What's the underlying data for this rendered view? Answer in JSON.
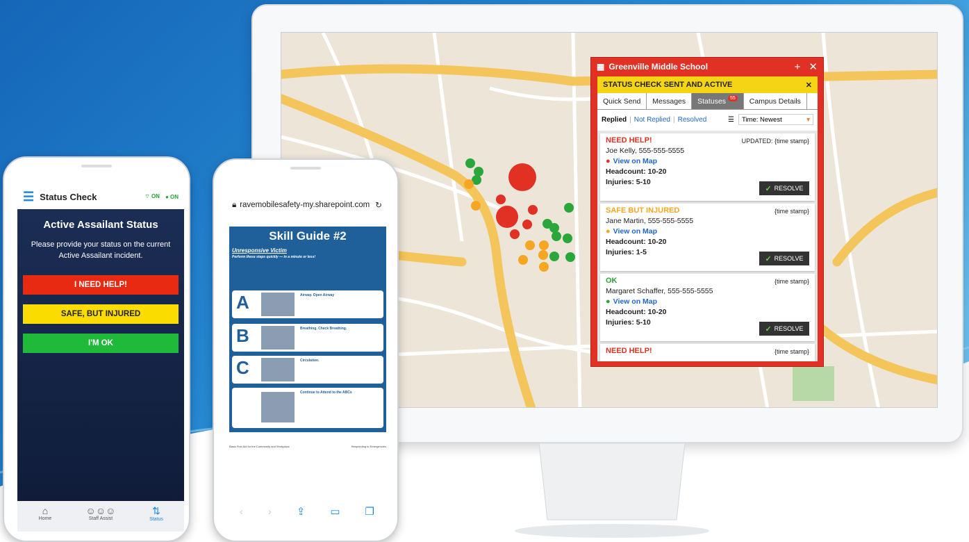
{
  "colors": {
    "accent": "#e03124",
    "banner": "#f5d416",
    "help": "#e82a12",
    "injured": "#fbdc00",
    "ok": "#1fba3a",
    "link": "#2266cc"
  },
  "panel": {
    "school": "Greenville Middle School",
    "banner": "STATUS CHECK SENT AND ACTIVE",
    "tabs": [
      {
        "label": "Quick Send"
      },
      {
        "label": "Messages"
      },
      {
        "label": "Statuses",
        "badge": "55"
      },
      {
        "label": "Campus Details"
      }
    ],
    "filters": {
      "replied": "Replied",
      "not_replied": "Not Replied",
      "resolved": "Resolved",
      "sort": "Time: Newest"
    },
    "cards": [
      {
        "status": "NEED HELP!",
        "color": "#e03124",
        "time": "UPDATED: {time stamp}",
        "name": "Joe Kelly, 555-555-5555",
        "view": "View on Map",
        "headcount": "Headcount: 10-20",
        "injuries": "Injuries: 5-10",
        "resolve": "RESOLVE"
      },
      {
        "status": "SAFE BUT INJURED",
        "color": "#f5a623",
        "time": "{time stamp}",
        "name": "Jane Martin, 555-555-5555",
        "view": "View on Map",
        "headcount": "Headcount: 10-20",
        "injuries": "Injuries: 1-5",
        "resolve": "RESOLVE"
      },
      {
        "status": "OK",
        "color": "#2aa63b",
        "time": "{time stamp}",
        "name": "Margaret Schaffer, 555-555-5555",
        "view": "View on Map",
        "headcount": "Headcount: 10-20",
        "injuries": "Injuries: 5-10",
        "resolve": "RESOLVE"
      },
      {
        "status": "NEED HELP!",
        "color": "#e03124",
        "time": "{time stamp}"
      }
    ]
  },
  "phone1": {
    "title": "Status Check",
    "wifi": "ON",
    "gps": "ON",
    "heading": "Active Assailant Status",
    "desc": "Please provide your status on the current Active Assailant incident.",
    "buttons": {
      "help": "I NEED HELP!",
      "injured": "SAFE, BUT INJURED",
      "ok": "I'M OK"
    },
    "nav": [
      {
        "label": "Home"
      },
      {
        "label": "Staff Assist"
      },
      {
        "label": "Status"
      }
    ]
  },
  "phone2": {
    "url": "ravemobilesafety-my.sharepoint.com",
    "doc_title": "Skill Guide #2",
    "doc_subtitle": "Unresponsive Victim",
    "doc_tagline": "Perform these steps quickly — in a minute or less!",
    "steps": [
      {
        "letter": "A",
        "heading": "Airway. Open Airway"
      },
      {
        "letter": "B",
        "heading": "Breathing. Check Breathing."
      },
      {
        "letter": "C",
        "heading": "Circulation."
      },
      {
        "letter": "",
        "heading": "Continue to Attend to the ABCs"
      }
    ],
    "footer_left": "Basic First Aid for the Community and Workplace",
    "footer_right": "Responding to Emergencies"
  }
}
